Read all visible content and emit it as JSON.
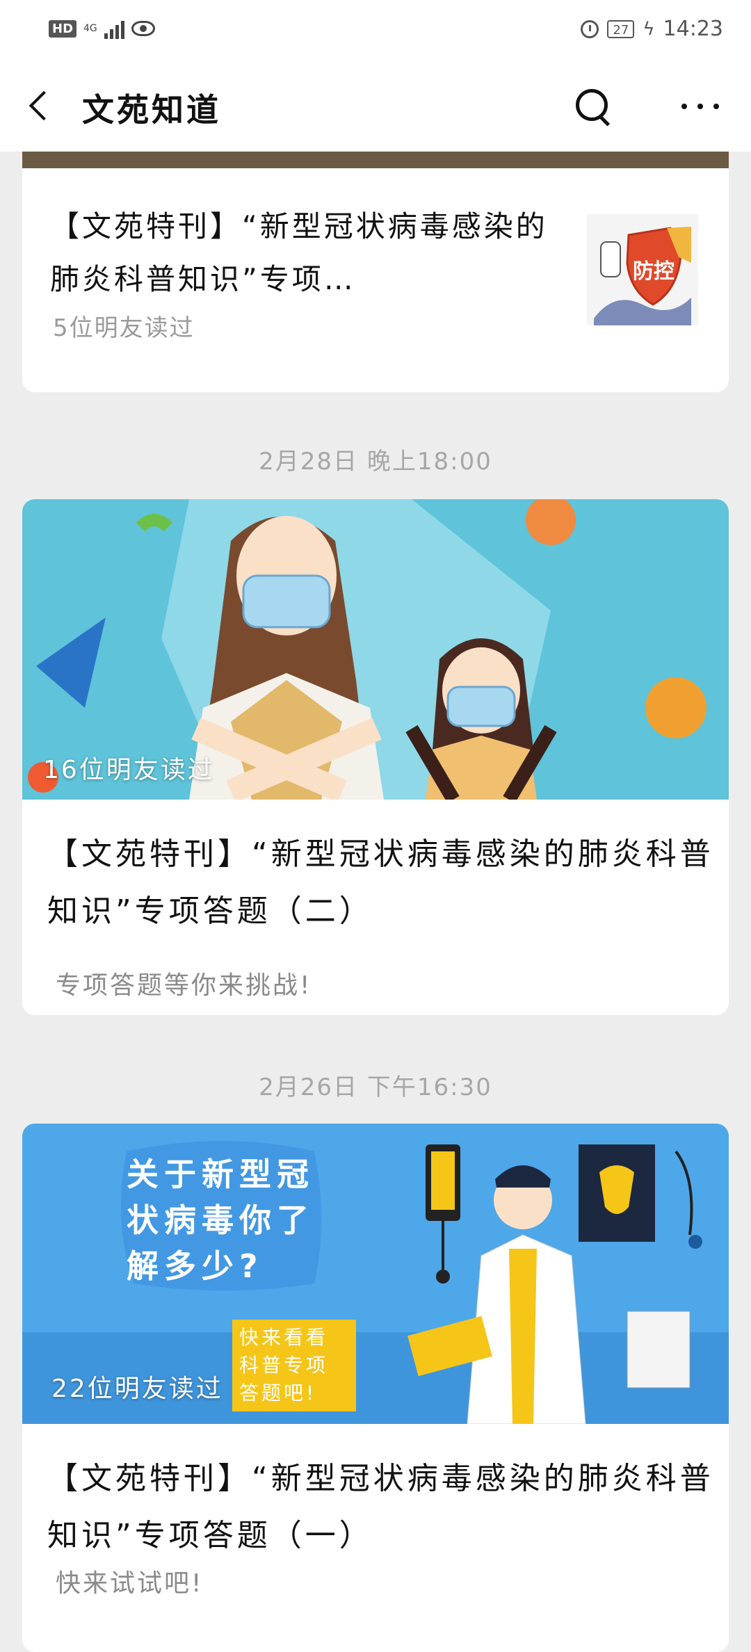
{
  "status_bar": {
    "hd": "HD",
    "network": "4G",
    "battery": "27",
    "time": "14:23"
  },
  "header": {
    "title": "文苑知道"
  },
  "articles": [
    {
      "title": "【文苑特刊】“新型冠状病毒感染的肺炎科普知识”专项…",
      "friends_read": "5位明友读过",
      "thumbnail_label": "防控"
    },
    {
      "date": "2月28日 晚上18:00",
      "friends_read": "16位明友读过",
      "title": "【文苑特刊】“新型冠状病毒感染的肺炎科普知识”专项答题（二）",
      "subtitle": "专项答题等你来挑战!"
    },
    {
      "date": "2月26日 下午16:30",
      "friends_read": "22位明友读过",
      "cover_heading": "关于新型冠状病毒你了解多少?",
      "cover_badge": "快来看看科普专项答题吧!",
      "title": "【文苑特刊】“新型冠状病毒感染的肺炎科普知识”专项答题（一）",
      "subtitle": "快来试试吧!"
    }
  ],
  "colors": {
    "background": "#ededed",
    "card": "#ffffff",
    "muted_text": "#9a9a9a",
    "cover2_sky": "#5fc3d9",
    "cover3_sky": "#4ea7e8"
  }
}
